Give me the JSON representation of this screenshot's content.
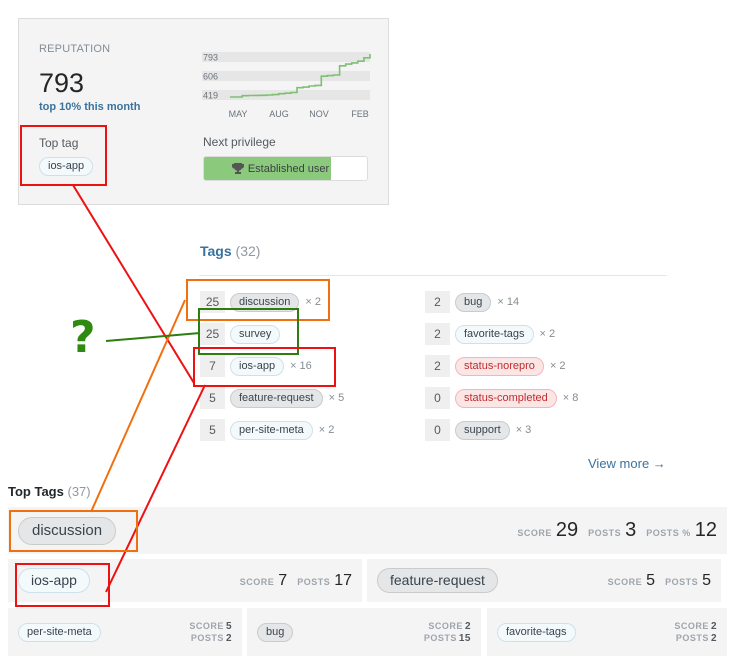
{
  "reputation": {
    "label": "REPUTATION",
    "value": "793",
    "rank_text": "top 10% this month",
    "top_tag_label": "Top tag",
    "top_tag": "ios-app",
    "chart": {
      "y_ticks": [
        "793",
        "606",
        "419"
      ],
      "x_ticks": [
        "MAY",
        "AUG",
        "NOV",
        "FEB"
      ],
      "line_color": "#7cc070",
      "series": [
        419,
        419,
        430,
        432,
        433,
        434,
        436,
        440,
        448,
        452,
        458,
        500,
        505,
        515,
        520,
        600,
        605,
        610,
        690,
        705,
        716,
        730,
        760,
        793
      ],
      "y_range": [
        419,
        793
      ]
    },
    "next_privilege_label": "Next privilege",
    "next_privilege": "Established user",
    "privilege_progress": 0.78
  },
  "tags": {
    "title": "Tags",
    "count": "(32)",
    "left_column": [
      {
        "score": "25",
        "name": "discussion",
        "style": "gray",
        "mult": "× 2"
      },
      {
        "score": "25",
        "name": "survey",
        "style": "blue",
        "mult": ""
      },
      {
        "score": "7",
        "name": "ios-app",
        "style": "blue",
        "mult": "× 16"
      },
      {
        "score": "5",
        "name": "feature-request",
        "style": "gray",
        "mult": "× 5"
      },
      {
        "score": "5",
        "name": "per-site-meta",
        "style": "blue",
        "mult": "× 2"
      }
    ],
    "right_column": [
      {
        "score": "2",
        "name": "bug",
        "style": "gray",
        "mult": "× 14"
      },
      {
        "score": "2",
        "name": "favorite-tags",
        "style": "blue",
        "mult": "× 2"
      },
      {
        "score": "2",
        "name": "status-norepro",
        "style": "red",
        "mult": "× 2"
      },
      {
        "score": "0",
        "name": "status-completed",
        "style": "red",
        "mult": "× 8"
      },
      {
        "score": "0",
        "name": "support",
        "style": "gray",
        "mult": "× 3"
      }
    ],
    "view_more": "View more →"
  },
  "top_tags": {
    "title": "Top Tags",
    "count": "(37)",
    "first": {
      "name": "discussion",
      "score_label": "SCORE",
      "score": "29",
      "posts_label": "POSTS",
      "posts": "3",
      "posts_pct_label": "POSTS %",
      "posts_pct": "12"
    },
    "second_row": [
      {
        "name": "ios-app",
        "style": "blue",
        "score_label": "SCORE",
        "score": "7",
        "posts_label": "POSTS",
        "posts": "17"
      },
      {
        "name": "feature-request",
        "style": "gray",
        "score_label": "SCORE",
        "score": "5",
        "posts_label": "POSTS",
        "posts": "5"
      }
    ],
    "third_row": [
      {
        "name": "per-site-meta",
        "style": "blue",
        "score_label": "SCORE",
        "score": "5",
        "posts_label": "POSTS",
        "posts": "2"
      },
      {
        "name": "bug",
        "style": "gray",
        "score_label": "SCORE",
        "score": "2",
        "posts_label": "POSTS",
        "posts": "15"
      },
      {
        "name": "favorite-tags",
        "style": "blue",
        "score_label": "SCORE",
        "score": "2",
        "posts_label": "POSTS",
        "posts": "2"
      }
    ]
  },
  "annotations": {
    "question_mark": "?",
    "colors": {
      "red": "#ee1111",
      "orange": "#f07010",
      "green": "#2e7d10"
    }
  }
}
